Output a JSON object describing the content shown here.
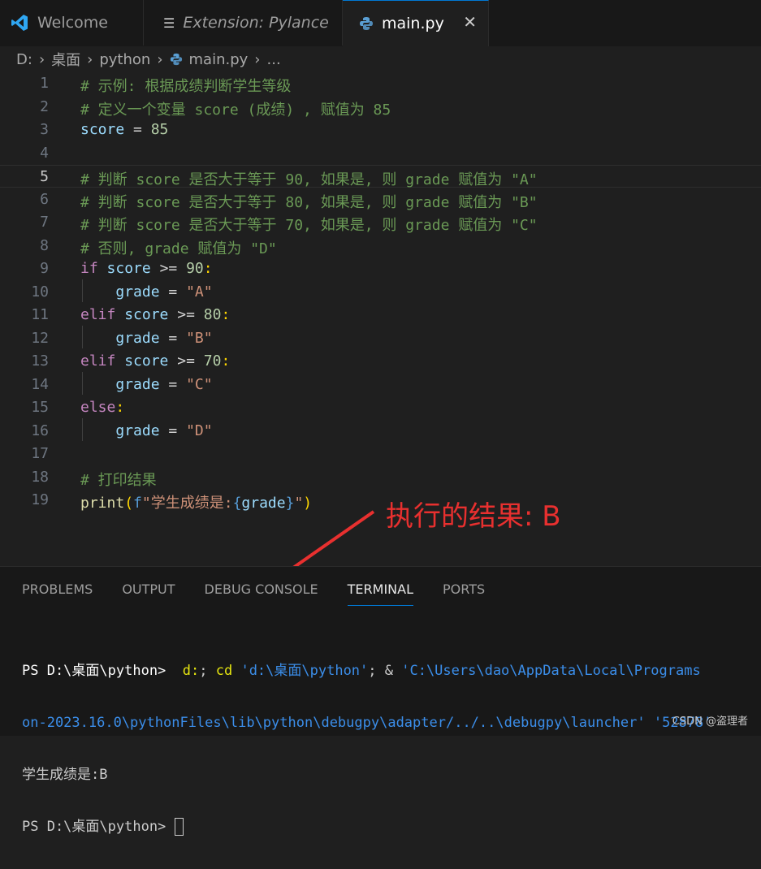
{
  "tabs": [
    {
      "label": "Welcome",
      "icon": "vscode-logo-icon"
    },
    {
      "label": "Extension: Pylance",
      "icon": "preview-icon"
    },
    {
      "label": "main.py",
      "icon": "python-icon",
      "close": "✕"
    }
  ],
  "breadcrumb": {
    "drive": "D:",
    "folder1": "桌面",
    "folder2": "python",
    "file": "main.py",
    "more": "..."
  },
  "code_lines": [
    "# 示例: 根据成绩判断学生等级",
    "# 定义一个变量 score (成绩) , 赋值为 85",
    "score = 85",
    "",
    "# 判断 score 是否大于等于 90, 如果是, 则 grade 赋值为 \"A\"",
    "# 判断 score 是否大于等于 80, 如果是, 则 grade 赋值为 \"B\"",
    "# 判断 score 是否大于等于 70, 如果是, 则 grade 赋值为 \"C\"",
    "# 否则, grade 赋值为 \"D\"",
    "if score >= 90:",
    "    grade = \"A\"",
    "elif score >= 80:",
    "    grade = \"B\"",
    "elif score >= 70:",
    "    grade = \"C\"",
    "else:",
    "    grade = \"D\"",
    "",
    "# 打印结果",
    "print(f\"学生成绩是:{grade}\")"
  ],
  "line_numbers": [
    "1",
    "2",
    "3",
    "4",
    "5",
    "6",
    "7",
    "8",
    "9",
    "10",
    "11",
    "12",
    "13",
    "14",
    "15",
    "16",
    "17",
    "18",
    "19"
  ],
  "annotation": "执行的结果: B",
  "panel": {
    "tabs": [
      "PROBLEMS",
      "OUTPUT",
      "DEBUG CONSOLE",
      "TERMINAL",
      "PORTS"
    ],
    "active_tab": "TERMINAL"
  },
  "terminal": {
    "prompt1": "PS D:\\桌面\\python> ",
    "cmd_part1": " d:",
    "cmd_part2": "; ",
    "cmd_cd": "cd",
    "cmd_arg1": " 'd:\\桌面\\python'",
    "cmd_part3": "; & ",
    "cmd_arg2": "'C:\\Users\\dao\\AppData\\Local\\Programs",
    "line2": "on-2023.16.0\\pythonFiles\\lib\\python\\debugpy\\adapter/../..\\debugpy\\launcher' '52878'",
    "output": "学生成绩是:B",
    "prompt2": "PS D:\\桌面\\python> "
  },
  "watermark": "CSDN @盗理者",
  "colors": {
    "accent": "#0078d4",
    "annotation": "#e8302f",
    "comment": "#6a9955",
    "keyword": "#c586c0"
  }
}
